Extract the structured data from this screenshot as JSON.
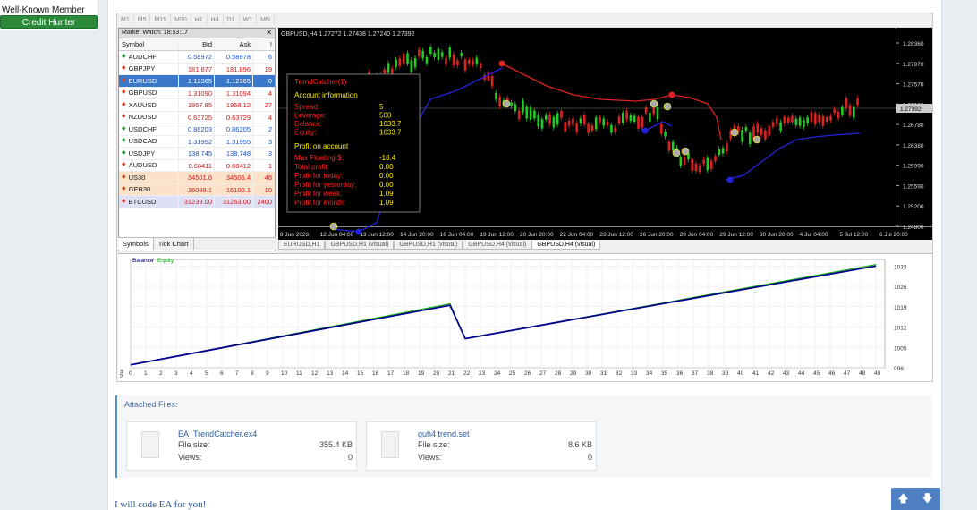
{
  "user": {
    "role": "Well-Known Member",
    "badge": "Credit Hunter"
  },
  "timeframes": [
    "M1",
    "M5",
    "M15",
    "M30",
    "H1",
    "H4",
    "D1",
    "W1",
    "MN"
  ],
  "market_watch": {
    "title": "Market Watch: 18:53:17",
    "headers": {
      "symbol": "Symbol",
      "bid": "Bid",
      "ask": "Ask",
      "spread": "!"
    },
    "rows": [
      {
        "symbol": "AUDCHF",
        "bid": "0.58972",
        "ask": "0.58978",
        "spread": "6",
        "dir": "up"
      },
      {
        "symbol": "GBPJPY",
        "bid": "181.877",
        "ask": "181.896",
        "spread": "19",
        "dir": "down"
      },
      {
        "symbol": "EURUSD",
        "bid": "1.12365",
        "ask": "1.12365",
        "spread": "0",
        "dir": "down",
        "selected": true
      },
      {
        "symbol": "GBPUSD",
        "bid": "1.31090",
        "ask": "1.31094",
        "spread": "4",
        "dir": "down"
      },
      {
        "symbol": "XAUUSD",
        "bid": "1957.85",
        "ask": "1958.12",
        "spread": "27",
        "dir": "down"
      },
      {
        "symbol": "NZDUSD",
        "bid": "0.63725",
        "ask": "0.63729",
        "spread": "4",
        "dir": "down"
      },
      {
        "symbol": "USDCHF",
        "bid": "0.86203",
        "ask": "0.86205",
        "spread": "2",
        "dir": "up"
      },
      {
        "symbol": "USDCAD",
        "bid": "1.31952",
        "ask": "1.31955",
        "spread": "3",
        "dir": "up"
      },
      {
        "symbol": "USDJPY",
        "bid": "138.745",
        "ask": "138.748",
        "spread": "3",
        "dir": "up"
      },
      {
        "symbol": "AUDUSD",
        "bid": "0.68411",
        "ask": "0.68412",
        "spread": "1",
        "dir": "down"
      },
      {
        "symbol": "US30",
        "bid": "34501.6",
        "ask": "34506.4",
        "spread": "48",
        "dir": "down",
        "group": "index"
      },
      {
        "symbol": "GER30",
        "bid": "16099.1",
        "ask": "16100.1",
        "spread": "10",
        "dir": "down",
        "group": "index"
      },
      {
        "symbol": "BTCUSD",
        "bid": "31239.00",
        "ask": "31263.00",
        "spread": "2400",
        "dir": "down",
        "group": "crypto"
      }
    ],
    "tabs": [
      "Symbols",
      "Tick Chart"
    ]
  },
  "chart": {
    "header": "GBPUSD,H4  1.27272 1.27438 1.27240 1.27392",
    "current_price": "1.27392",
    "price_labels": [
      "1.28360",
      "1.27970",
      "1.27570",
      "1.27180",
      "1.26780",
      "1.26380",
      "1.25990",
      "1.25590",
      "1.25200",
      "1.24800"
    ],
    "time_labels": [
      "8 Jun 2023",
      "12 Jun 04:00",
      "13 Jun 12:00",
      "14 Jun 20:00",
      "16 Jun 04:00",
      "19 Jun 12:00",
      "20 Jun 20:00",
      "22 Jun 04:00",
      "23 Jun 12:00",
      "26 Jun 20:00",
      "28 Jun 04:00",
      "29 Jun 12:00",
      "30 Jun 20:00",
      "4 Jul 04:00",
      "5 Jul 12:00",
      "6 Jul 20:00"
    ],
    "info_panel": {
      "title": "TrendCatcher(1)",
      "account_heading": "Account information",
      "account": [
        {
          "label": "Spread:",
          "value": "5"
        },
        {
          "label": "Leverage:",
          "value": "500"
        },
        {
          "label": "Balance:",
          "value": "1033.7"
        },
        {
          "label": "Equity:",
          "value": "1033.7"
        }
      ],
      "profit_heading": "Profit on account",
      "profit": [
        {
          "label": "Max Floating $:",
          "value": "-18.4"
        },
        {
          "label": "Total profit:",
          "value": "0.00"
        },
        {
          "label": "Profit for today:",
          "value": "0.00"
        },
        {
          "label": "Profit for yesterday:",
          "value": "0.00"
        },
        {
          "label": "Profit for week:",
          "value": "1.09"
        },
        {
          "label": "Profit for month:",
          "value": "1.09"
        }
      ]
    }
  },
  "chart_tabs": [
    "EURUSD,H1",
    "GBPUSD,H1 (visual)",
    "GBPUSD,H1 (visual)",
    "GBPUSD,H4 (visual)",
    "GBPUSD,H4 (visual)"
  ],
  "tester": {
    "legend_balance": "Balance",
    "legend_sep": " / ",
    "legend_equity": "Equity",
    "side_label": "ster"
  },
  "chart_data": {
    "type": "line",
    "x": [
      0,
      21,
      22,
      49
    ],
    "series": [
      {
        "name": "Balance",
        "values": [
          999,
          1019.5,
          1008,
          1033
        ]
      },
      {
        "name": "Equity",
        "values": [
          999,
          1020,
          1008,
          1033.5
        ]
      }
    ],
    "ylim": [
      998,
      1034
    ],
    "yticks": [
      1033,
      1026,
      1019,
      1012,
      1005,
      998
    ],
    "xticks": [
      0,
      1,
      2,
      3,
      4,
      5,
      6,
      7,
      8,
      9,
      10,
      11,
      12,
      13,
      14,
      15,
      16,
      17,
      18,
      19,
      20,
      21,
      22,
      23,
      24,
      25,
      26,
      27,
      28,
      29,
      30,
      31,
      32,
      33,
      34,
      35,
      36,
      37,
      38,
      39,
      40,
      41,
      42,
      43,
      44,
      45,
      46,
      47,
      48,
      49
    ],
    "colors": {
      "balance": "#00008b",
      "equity": "#00b000"
    }
  },
  "attachments": {
    "title": "Attached Files:",
    "size_label": "File size:",
    "views_label": "Views:",
    "files": [
      {
        "name": "EA_TrendCatcher.ex4",
        "size": "355.4 KB",
        "views": "0"
      },
      {
        "name": "guh4 trend.set",
        "size": "8.6 KB",
        "views": "0"
      }
    ]
  },
  "signature": "I will code EA for you!",
  "nav": {
    "up": "🡅",
    "down": "🡇"
  }
}
